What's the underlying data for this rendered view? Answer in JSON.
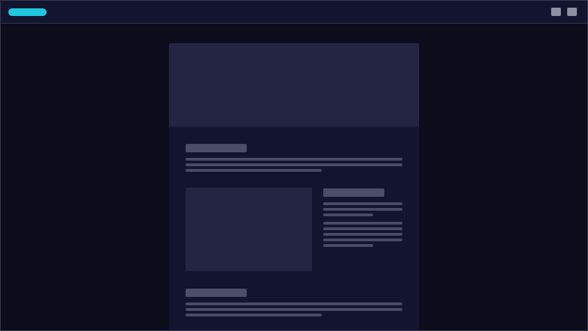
{
  "app": {
    "title": "",
    "accent_color": "#1fc8e0"
  },
  "topbar": {
    "logo": {
      "shape": "pill",
      "color": "#1fc8e0"
    },
    "window_controls": [
      {
        "icon": "square-icon"
      },
      {
        "icon": "square-icon"
      }
    ]
  },
  "document": {
    "hero_image": {
      "state": "placeholder"
    },
    "sections": [
      {
        "heading": "",
        "lines": 3
      },
      {
        "heading": "",
        "lines": 9,
        "has_media": true
      },
      {
        "heading": "",
        "lines": 3
      }
    ]
  },
  "colors": {
    "background": "#0b0d1b",
    "topbar": "#13152f",
    "panel": "#13152f",
    "placeholder_block": "#232542",
    "skeleton_line": "#4a4c66"
  }
}
